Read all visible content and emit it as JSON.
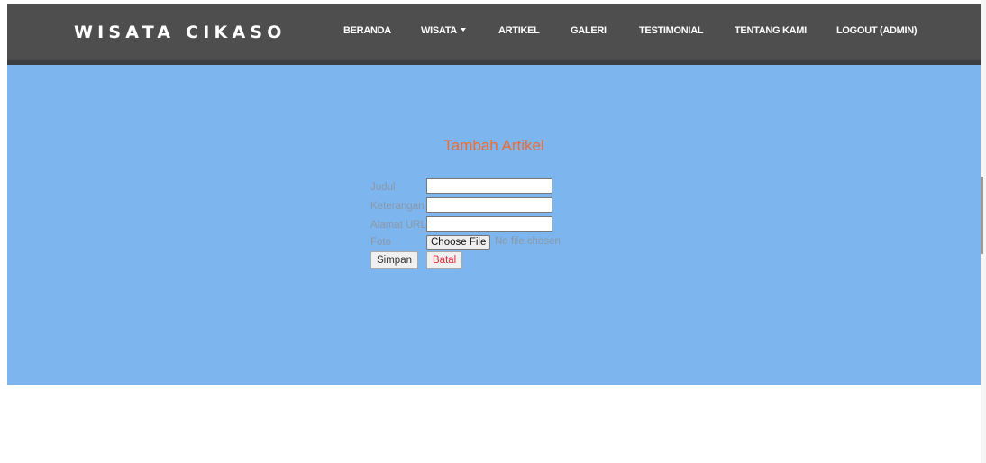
{
  "navbar": {
    "brand": "WISATA CIKASO",
    "items": [
      {
        "label": "BERANDA"
      },
      {
        "label": "WISATA"
      },
      {
        "label": "ARTIKEL"
      },
      {
        "label": "GALERI"
      },
      {
        "label": "TESTIMONIAL"
      },
      {
        "label": "TENTANG KAMI"
      },
      {
        "label": "LOGOUT (ADMIN)"
      }
    ]
  },
  "form": {
    "title": "Tambah Artikel",
    "fields": [
      {
        "label": "Judul",
        "value": ""
      },
      {
        "label": "Keterangan",
        "value": ""
      },
      {
        "label": "Alamat URL",
        "value": ""
      }
    ],
    "photo": {
      "label": "Foto",
      "button_label": "Choose File",
      "status": "No file chosen"
    },
    "save_label": "Simpan",
    "cancel_label": "Batal"
  },
  "colors": {
    "navbar_bg": "#4e4e4e",
    "hero_bg": "#7db6ee",
    "title": "#f26a2e",
    "cancel_text": "#e0313a",
    "label_text": "#8b97a6"
  },
  "icons": {
    "dropdown": "caret-down-icon"
  }
}
